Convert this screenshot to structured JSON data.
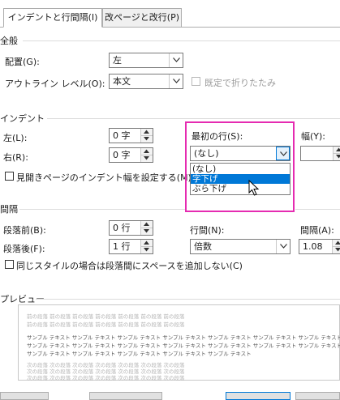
{
  "tabs": [
    {
      "label": "インデントと行間隔(I)"
    },
    {
      "label": "改ページと改行(P)"
    }
  ],
  "general": {
    "title": "全般",
    "alignment_label": "配置(G):",
    "alignment_value": "左",
    "outline_label": "アウトライン レベル(O):",
    "outline_value": "本文",
    "collapsed_label": "既定で折りたたみ"
  },
  "indent": {
    "title": "インデント",
    "left_label": "左(L):",
    "left_value": "0 字",
    "right_label": "右(R):",
    "right_value": "0 字",
    "mirror_label": "見開きページのインデント幅を設定する(M)",
    "first_line_label": "最初の行(S):",
    "first_line_value": "(なし)",
    "by_label": "幅(Y):",
    "first_line_options": [
      "(なし)",
      "字下げ",
      "ぶら下げ"
    ],
    "first_line_selected_index": 1
  },
  "spacing": {
    "title": "間隔",
    "before_label": "段落前(B):",
    "before_value": "0 行",
    "after_label": "段落後(F):",
    "after_value": "1 行",
    "line_spacing_label": "行間(N):",
    "line_spacing_value": "倍数",
    "at_label": "間隔(A):",
    "at_value": "1.08",
    "no_space_label": "同じスタイルの場合は段落間にスペースを追加しない(C)"
  },
  "preview": {
    "title": "プレビュー",
    "prev_lines": [
      "前の段落 前の段落 前の段落 前の段落 前の段落 前の段落 前の段落",
      "前の段落 前の段落 前の段落 前の段落 前の段落 前の段落 前の段落"
    ],
    "sample_lines": [
      "サンプル テキスト サンプル テキスト サンプル テキスト サンプル テキスト サンプル テキスト サンプル テキスト サンプル テキスト",
      "サンプル テキスト サンプル テキスト サンプル テキスト サンプル テキスト サンプル テキスト サンプル テキスト サンプル テキスト",
      "サンプル テキスト サンプル テキスト サンプル テキスト サンプル テキスト サンプル テキスト"
    ],
    "next_lines": [
      "次の段落 次の段落 次の段落 次の段落 次の段落 次の段落 次の段落",
      "次の段落 次の段落 次の段落 次の段落 次の段落 次の段落 次の段落",
      "次の段落 次の段落 次の段落 次の段落 次の段落 次の段落 次の段落"
    ]
  },
  "colors": {
    "highlight": "#e52bb1",
    "selection": "#0078d7"
  }
}
